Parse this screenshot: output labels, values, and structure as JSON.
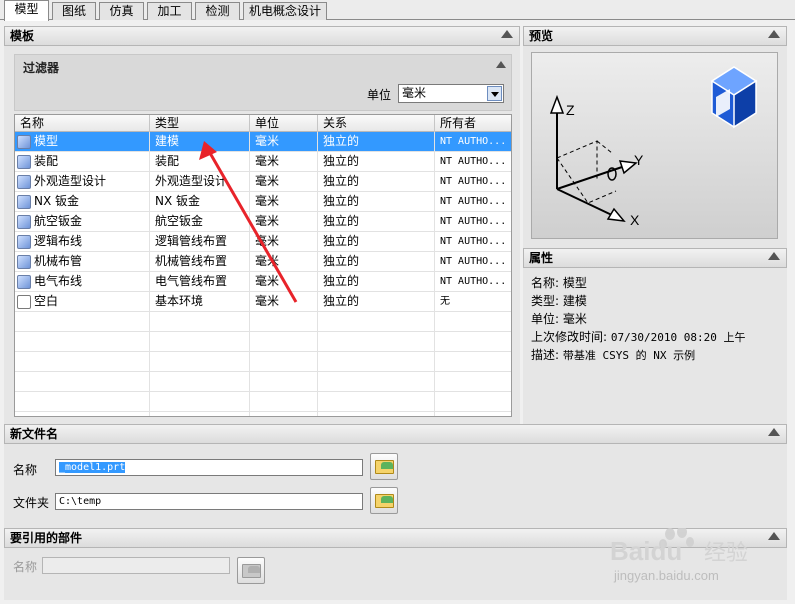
{
  "tabs": [
    {
      "label": "模型",
      "active": true
    },
    {
      "label": "图纸",
      "active": false
    },
    {
      "label": "仿真",
      "active": false
    },
    {
      "label": "加工",
      "active": false
    },
    {
      "label": "检测",
      "active": false
    },
    {
      "label": "机电概念设计",
      "active": false
    }
  ],
  "templates": {
    "title": "模板",
    "filter": {
      "title": "过滤器",
      "unit_label": "单位",
      "unit_value": "毫米"
    },
    "columns": [
      "名称",
      "类型",
      "单位",
      "关系",
      "所有者"
    ],
    "rows": [
      {
        "name": "模型",
        "type": "建模",
        "unit": "毫米",
        "relation": "独立的",
        "owner": "NT AUTHO...",
        "icon": "model-icon",
        "selected": true
      },
      {
        "name": "装配",
        "type": "装配",
        "unit": "毫米",
        "relation": "独立的",
        "owner": "NT AUTHO...",
        "icon": "assembly-icon",
        "selected": false
      },
      {
        "name": "外观造型设计",
        "type": "外观造型设计",
        "unit": "毫米",
        "relation": "独立的",
        "owner": "NT AUTHO...",
        "icon": "shape-studio-icon",
        "selected": false
      },
      {
        "name": "NX 钣金",
        "type": "NX 钣金",
        "unit": "毫米",
        "relation": "独立的",
        "owner": "NT AUTHO...",
        "icon": "sheet-metal-icon",
        "selected": false
      },
      {
        "name": "航空钣金",
        "type": "航空钣金",
        "unit": "毫米",
        "relation": "独立的",
        "owner": "NT AUTHO...",
        "icon": "aero-sheet-metal-icon",
        "selected": false
      },
      {
        "name": "逻辑布线",
        "type": "逻辑管线布置",
        "unit": "毫米",
        "relation": "独立的",
        "owner": "NT AUTHO...",
        "icon": "logical-routing-icon",
        "selected": false
      },
      {
        "name": "机械布管",
        "type": "机械管线布置",
        "unit": "毫米",
        "relation": "独立的",
        "owner": "NT AUTHO...",
        "icon": "mechanical-routing-icon",
        "selected": false
      },
      {
        "name": "电气布线",
        "type": "电气管线布置",
        "unit": "毫米",
        "relation": "独立的",
        "owner": "NT AUTHO...",
        "icon": "electrical-routing-icon",
        "selected": false
      },
      {
        "name": "空白",
        "type": "基本环境",
        "unit": "毫米",
        "relation": "独立的",
        "owner": "无",
        "icon": "blank-document-icon",
        "selected": false
      }
    ]
  },
  "preview": {
    "title": "预览",
    "axes": [
      "Z",
      "Y",
      "X"
    ]
  },
  "properties": {
    "title": "属性",
    "items": [
      {
        "label": "名称:",
        "value": "模型"
      },
      {
        "label": "类型:",
        "value": "建模"
      },
      {
        "label": "单位:",
        "value": "毫米"
      },
      {
        "label": "上次修改时间:",
        "value": "07/30/2010 08:20 上午"
      },
      {
        "label": "描述:",
        "value": "带基准 CSYS 的 NX 示例"
      }
    ]
  },
  "new_file": {
    "title": "新文件名",
    "name_label": "名称",
    "name_value": "_model1.prt",
    "folder_label": "文件夹",
    "folder_value": "C:\\temp"
  },
  "referenced": {
    "title": "要引用的部件",
    "name_label": "名称",
    "name_value": ""
  },
  "watermark": {
    "brand": "Baidu",
    "cn": "经验",
    "url": "jingyan.baidu.com"
  },
  "colors": {
    "selection": "#3399ff",
    "annotation_arrow": "#e8232a",
    "header_bg": "#dcdcdc"
  }
}
